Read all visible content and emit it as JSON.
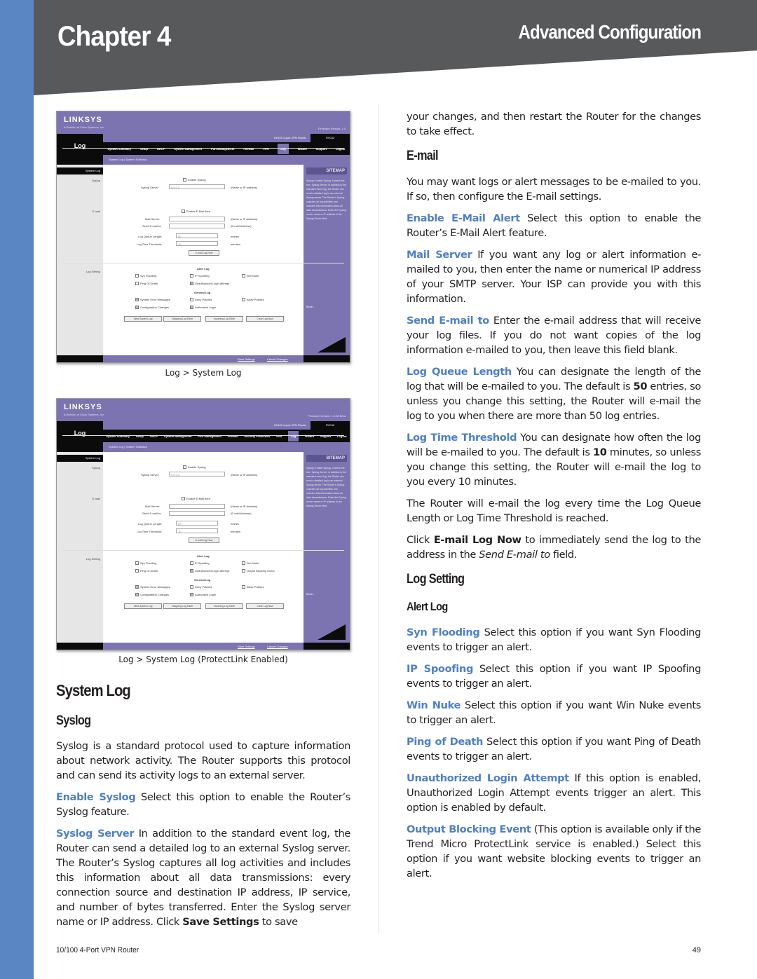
{
  "header": {
    "chapter": "Chapter 4",
    "section": "Advanced Configuration"
  },
  "colors": {
    "accent_blue": "#5a86c4",
    "term_blue": "#4f7fc4",
    "header_gray": "#58595b",
    "router_ui_purple": "#7c74b0"
  },
  "screenshots": [
    {
      "caption": "Log > System Log",
      "logo": "LINKSYS",
      "logo_sub": "A Division of Cisco Systems, Inc.",
      "firmware": "Firmware Version: 1.0",
      "page_label": "Log",
      "model_name": "10/100 4-port VPN Router",
      "model_id": "RV042",
      "nav": [
        "System Summary",
        "Setup",
        "DHCP",
        "System Management",
        "Port Management",
        "Firewall",
        "VPN",
        "Log",
        "Wizard",
        "Support",
        "Logout"
      ],
      "active_nav": "Log",
      "subnav": "System Log  |  System Statistics",
      "side_head": "System Log",
      "side_labels": [
        "Syslog",
        "E-mail",
        "Log Setting"
      ],
      "sitemap": "SITEMAP",
      "help_more": "More...",
      "help_text": "Syslog: Enable Syslog. It check the box. Syslog Server: In addition to the standard event log, the Router can send a detailed log to an external Syslog server. The Router's Syslog captures all log activities and includes this information about all data transmissions. Enter the Syslog server name or IP address in the Syslog Server field.",
      "fields": {
        "enable_syslog": "Enable Syslog",
        "syslog_server": "Syslog Server:",
        "syslog_server_value": "0.0.0.0",
        "syslog_hint": "(Name or IP address)",
        "enable_email": "Enable E-Mail Alert",
        "mail_server": "Mail Server:",
        "mail_hint": "(Name or IP Address)",
        "send_email": "Send E-mail to:",
        "send_hint": "(E-mail Address)",
        "queue_length": "Log Queue Length:",
        "queue_value": "50",
        "queue_unit": "entries",
        "time_threshold": "Log Time Threshold:",
        "time_value": "10",
        "time_unit": "minutes",
        "email_now": "E-mail Log Now"
      },
      "alert_log_title": "Alert Log",
      "alert_log": [
        {
          "label": "Syn Flooding",
          "checked": false
        },
        {
          "label": "IP Spoofing",
          "checked": false
        },
        {
          "label": "Win Nuke",
          "checked": false
        },
        {
          "label": "Ping Of Death",
          "checked": false
        },
        {
          "label": "Unauthorized Login Attempt",
          "checked": true
        }
      ],
      "general_log_title": "General Log",
      "general_log": [
        {
          "label": "System Error Messages",
          "checked": true
        },
        {
          "label": "Deny Policies",
          "checked": false
        },
        {
          "label": "Allow Policies",
          "checked": false
        },
        {
          "label": "Configuration Changes",
          "checked": true
        },
        {
          "label": "Authorized Login",
          "checked": true
        }
      ],
      "buttons": [
        "View System Log",
        "Outgoing Log Table",
        "Incoming Log Table",
        "Clear Log Now"
      ],
      "save": "Save Settings",
      "cancel": "Cancel Changes"
    },
    {
      "caption": "Log > System Log (ProtectLink Enabled)",
      "logo": "LINKSYS",
      "logo_sub": "A Division of Cisco Systems, Inc.",
      "firmware": "Firmware Version: 1.3.98 Beta",
      "page_label": "Log",
      "model_name": "10/100 4-port VPN Router",
      "model_id": "RV042",
      "nav": [
        "System Summary",
        "Setup",
        "DHCP",
        "System Management",
        "Port Management",
        "Firewall",
        "Security Protection",
        "VPN",
        "Log",
        "Wizard",
        "Support",
        "Logout"
      ],
      "active_nav": "Log",
      "subnav": "System Log  |  System Statistics",
      "side_head": "System Log",
      "side_labels": [
        "Syslog",
        "E-mail",
        "Log Setting"
      ],
      "sitemap": "SITEMAP",
      "help_more": "More...",
      "help_text": "Syslog: Enable Syslog. It check the box. Syslog Server: In addition to the standard event log, the Router can send a detailed log to an external Syslog server. The Router's Syslog captures all log activities and includes this information about all data transmissions. Enter the Syslog server name or IP address in the Syslog Server field.",
      "fields": {
        "enable_syslog": "Enable Syslog",
        "syslog_server": "Syslog Server:",
        "syslog_server_value": "0.0.0.0",
        "syslog_hint": "(Name or IP Address)",
        "enable_email": "Enable E-Mail Alert",
        "mail_server": "Mail Server:",
        "mail_hint": "(Name or IP Address)",
        "send_email": "Send E-mail to:",
        "send_hint": "(E-mail Address)",
        "queue_length": "Log Queue Length:",
        "queue_value": "50",
        "queue_unit": "entries",
        "time_threshold": "Log Time Threshold:",
        "time_value": "10",
        "time_unit": "minutes",
        "email_now": "E-mail Log Now"
      },
      "alert_log_title": "Alert Log",
      "alert_log": [
        {
          "label": "Syn Flooding",
          "checked": false
        },
        {
          "label": "IP Spoofing",
          "checked": false
        },
        {
          "label": "Win Nuke",
          "checked": false
        },
        {
          "label": "Ping Of Death",
          "checked": false
        },
        {
          "label": "Unauthorized Login Attempt",
          "checked": true
        },
        {
          "label": "Output Blocking Event",
          "checked": false
        }
      ],
      "general_log_title": "General Log",
      "general_log": [
        {
          "label": "System Error Messages",
          "checked": true
        },
        {
          "label": "Deny Policies",
          "checked": false
        },
        {
          "label": "Allow Policies",
          "checked": false
        },
        {
          "label": "Configuration Changes",
          "checked": true
        },
        {
          "label": "Authorized Login",
          "checked": true
        }
      ],
      "buttons": [
        "View System Log",
        "Outgoing Log Table",
        "Incoming Log Table",
        "Clear Log Now"
      ],
      "save": "Save Settings",
      "cancel": "Cancel Changes"
    }
  ],
  "left": {
    "heading": "System Log",
    "subheading": "Syslog",
    "intro": "Syslog is a standard protocol used to capture information about network activity. The Router supports this protocol and can send its activity logs to an external server.",
    "enable_syslog_term": "Enable Syslog",
    "enable_syslog_text": " Select this option to enable the Router’s Syslog feature.",
    "syslog_server_term": "Syslog Server",
    "syslog_server_text_1": " In addition to the standard event log, the Router can send a detailed log to an external Syslog server. The Router’s Syslog captures all log activities and includes this information about all data transmissions: every connection source and destination IP address, IP service, and number of bytes transferred. Enter the Syslog server name or IP address. Click ",
    "syslog_server_bold": "Save Settings",
    "syslog_server_text_2": " to save"
  },
  "right": {
    "continuation": "your changes, and then restart the Router for the changes to take effect.",
    "email_heading": "E-mail",
    "email_intro": "You may want logs or alert messages to be e-mailed to you. If so, then configure the E-mail settings.",
    "items_email": [
      {
        "term": "Enable E-Mail Alert",
        "text": " Select this option to enable the Router’s E-Mail Alert feature."
      },
      {
        "term": "Mail Server",
        "text": " If you want any log or alert information e-mailed to you, then enter the name or numerical IP address of your SMTP server. Your ISP can provide you with this information."
      },
      {
        "term": "Send E-mail to",
        "text": " Enter the e-mail address that will receive your log files. If you do not want copies of the log information e-mailed to you, then leave this field blank."
      }
    ],
    "queue_term": "Log Queue Length",
    "queue_text_1": "  You can designate the length of the log that will be e-mailed to you. The default is ",
    "queue_bold": "50",
    "queue_text_2": " entries, so unless you change this setting, the Router will e-mail the log to you when there are more than 50 log entries.",
    "threshold_term": "Log Time Threshold",
    "threshold_text_1": "  You can designate how often the log will be e-mailed to you. The default is ",
    "threshold_bold": "10",
    "threshold_text_2": " minutes, so unless you change this setting, the Router will e-mail the log to you every 10 minutes.",
    "router_note": "The Router will e-mail the log every time the Log Queue Length or Log Time Threshold is reached.",
    "click_prefix": "Click ",
    "click_bold": "E-mail Log Now",
    "click_mid": " to immediately send the log to the address in the ",
    "click_italic": "Send E-mail to",
    "click_suffix": " field.",
    "log_setting_heading": "Log Setting",
    "alert_log_heading": "Alert Log",
    "items_alert": [
      {
        "term": "Syn Flooding",
        "text": "  Select this option if you want Syn Flooding events to trigger an alert."
      },
      {
        "term": "IP Spoofing",
        "text": "  Select this option if you want IP Spoofing events to trigger an alert."
      },
      {
        "term": "Win Nuke",
        "text": "  Select this option if you want Win Nuke events to trigger an alert."
      },
      {
        "term": "Ping of Death",
        "text": " Select this option if you want Ping of Death events to trigger an alert."
      },
      {
        "term": "Unauthorized Login Attempt",
        "text": "  If this option is enabled, Unauthorized Login Attempt events trigger an alert. This option is enabled by default."
      },
      {
        "term": "Output Blocking Event",
        "text": "  (This option is available only if the Trend Micro ProtectLink service is enabled.) Select this option if you want website blocking events to trigger an alert."
      }
    ]
  },
  "footer": {
    "product": "10/100 4-Port VPN Router",
    "page_number": "49"
  }
}
